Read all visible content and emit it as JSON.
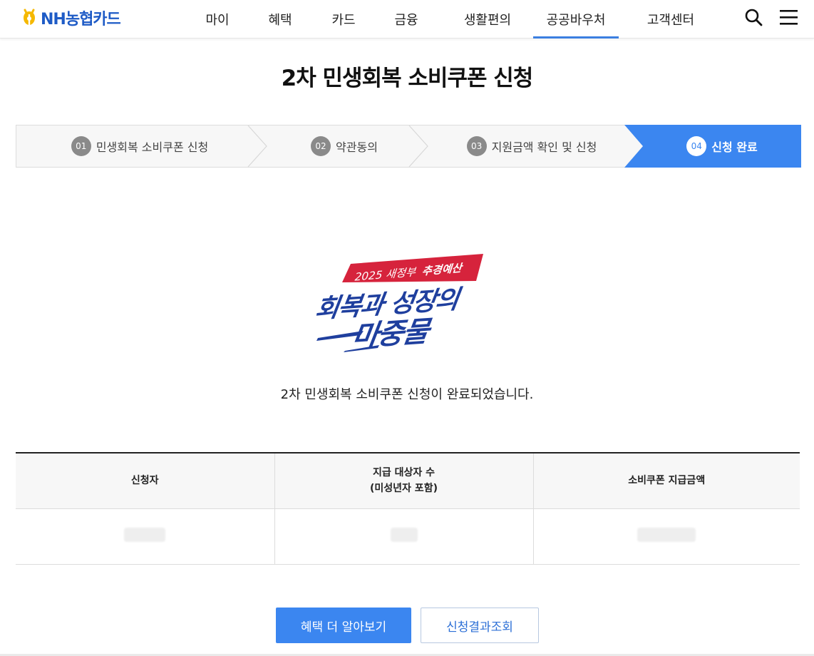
{
  "header": {
    "logo_text": "NH농협카드",
    "brand_color": "#1e5bc6",
    "nav": [
      {
        "label": "마이"
      },
      {
        "label": "혜택"
      },
      {
        "label": "카드"
      },
      {
        "label": "금융"
      },
      {
        "label": "생활편의"
      },
      {
        "label": "공공바우처",
        "active": true
      },
      {
        "label": "고객센터"
      }
    ],
    "icons": [
      "search-icon",
      "menu-icon"
    ]
  },
  "page_title": "2차 민생회복 소비쿠폰 신청",
  "steps": [
    {
      "num": "01",
      "label": "민생회복 소비쿠폰 신청"
    },
    {
      "num": "02",
      "label": "약관동의"
    },
    {
      "num": "03",
      "label": "지원금액 확인 및 신청"
    },
    {
      "num": "04",
      "label": "신청 완료",
      "active": true
    }
  ],
  "accent_color": "#3b86f0",
  "campaign": {
    "badge": "2025 새정부",
    "badge_em": "추경예산",
    "line1": "회복과 성장의",
    "line2": "마중물",
    "badge_color": "#d6233c",
    "text_color": "#1f3f9e"
  },
  "complete_message": "2차 민생회복 소비쿠폰 신청이 완료되었습니다.",
  "table": {
    "headers": [
      {
        "line1": "신청자",
        "line2": ""
      },
      {
        "line1": "지급 대상자 수",
        "line2": "(미성년자 포함)"
      },
      {
        "line1": "소비쿠폰 지급금액",
        "line2": ""
      }
    ],
    "rows_redacted": true
  },
  "buttons": {
    "primary": "혜택 더 알아보기",
    "secondary": "신청결과조회"
  }
}
